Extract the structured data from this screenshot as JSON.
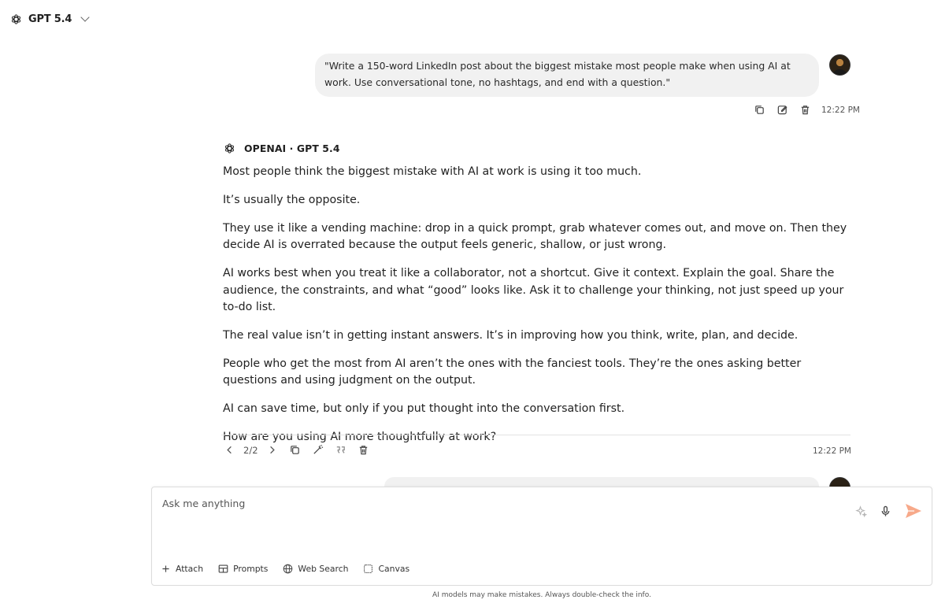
{
  "header": {
    "model_name": "GPT 5.4"
  },
  "user_message": {
    "text": "\"Write a 150-word LinkedIn post about the biggest mistake most people make when using AI at work. Use conversational tone, no hashtags, and end with a question.\"",
    "time": "12:22 PM"
  },
  "assistant_message": {
    "label": "OPENAI · GPT 5.4",
    "paragraphs": [
      "Most people think the biggest mistake with AI at work is using it too much.",
      "It’s usually the opposite.",
      "They use it like a vending machine: drop in a quick prompt, grab whatever comes out, and move on. Then they decide AI is overrated because the output feels generic, shallow, or just wrong.",
      "AI works best when you treat it like a collaborator, not a shortcut. Give it context. Explain the goal. Share the audience, the constraints, and what “good” looks like. Ask it to challenge your thinking, not just speed up your to-do list.",
      "The real value isn’t in getting instant answers. It’s in improving how you think, write, plan, and decide.",
      "People who get the most from AI aren’t the ones with the fanciest tools. They’re the ones asking better questions and using judgment on the output.",
      "AI can save time, but only if you put thought into the conversation first.",
      "How are you using AI more thoughtfully at work?"
    ],
    "pager": "2/2",
    "time": "12:22 PM"
  },
  "composer": {
    "placeholder": "Ask me anything",
    "tools": {
      "attach": "Attach",
      "prompts": "Prompts",
      "web_search": "Web Search",
      "canvas": "Canvas"
    }
  },
  "footer": {
    "disclaimer": "AI models may make mistakes. Always double-check the info."
  },
  "colors": {
    "accent_send": "#f7a98a",
    "bubble_bg": "#f1f1f1"
  },
  "icons": [
    "openai-logo-icon",
    "chevron-down-icon",
    "copy-icon",
    "edit-icon",
    "trash-icon",
    "chevron-left-icon",
    "chevron-right-icon",
    "magic-wand-icon",
    "quote-icon",
    "sparkle-icon",
    "microphone-icon",
    "send-icon",
    "plus-icon",
    "table-icon",
    "globe-icon",
    "canvas-icon"
  ]
}
